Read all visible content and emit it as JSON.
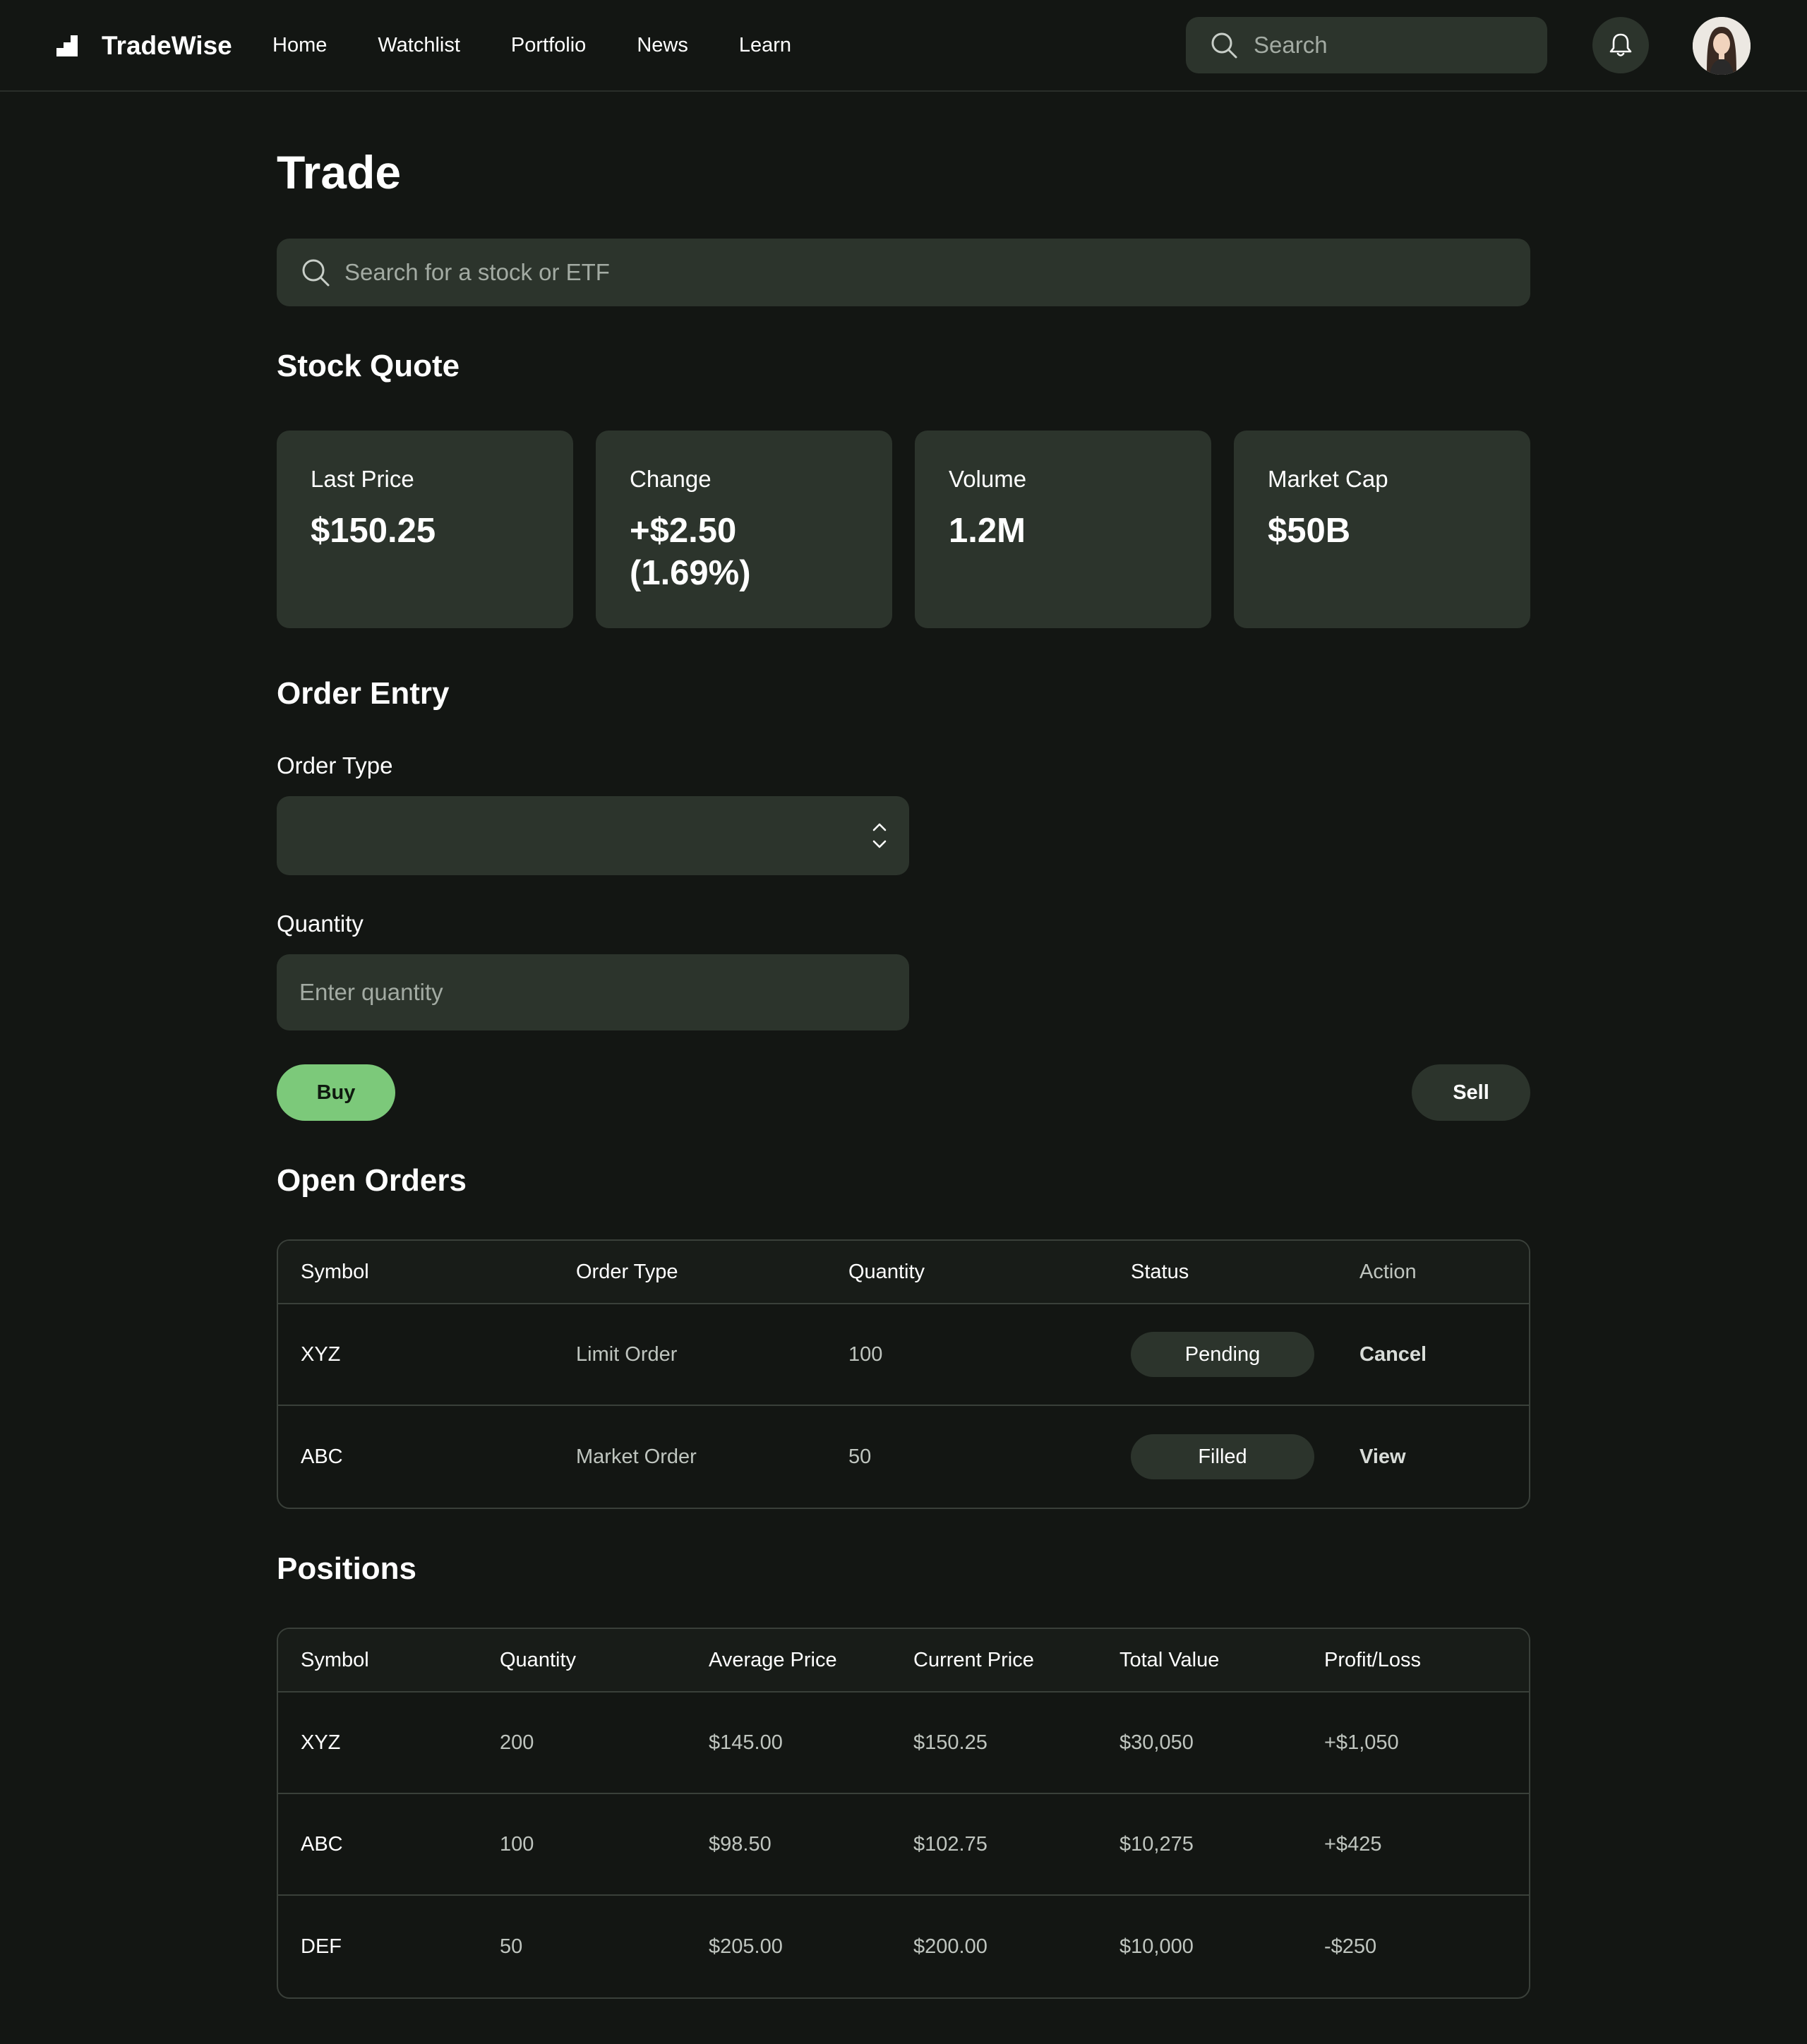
{
  "app": {
    "name": "TradeWise"
  },
  "nav": [
    {
      "label": "Home"
    },
    {
      "label": "Watchlist"
    },
    {
      "label": "Portfolio"
    },
    {
      "label": "News"
    },
    {
      "label": "Learn"
    }
  ],
  "header": {
    "search_placeholder": "Search"
  },
  "page": {
    "title": "Trade",
    "search_placeholder": "Search for a stock or ETF"
  },
  "quote": {
    "title": "Stock Quote",
    "cards": [
      {
        "label": "Last Price",
        "value": "$150.25"
      },
      {
        "label": "Change",
        "value": "+$2.50 (1.69%)"
      },
      {
        "label": "Volume",
        "value": "1.2M"
      },
      {
        "label": "Market Cap",
        "value": "$50B"
      }
    ]
  },
  "order_entry": {
    "title": "Order Entry",
    "order_type_label": "Order Type",
    "order_type_value": "",
    "quantity_label": "Quantity",
    "quantity_placeholder": "Enter quantity",
    "buy_label": "Buy",
    "sell_label": "Sell"
  },
  "open_orders": {
    "title": "Open Orders",
    "columns": [
      "Symbol",
      "Order Type",
      "Quantity",
      "Status",
      "Action"
    ],
    "rows": [
      {
        "symbol": "XYZ",
        "order_type": "Limit Order",
        "quantity": "100",
        "status": "Pending",
        "action": "Cancel"
      },
      {
        "symbol": "ABC",
        "order_type": "Market Order",
        "quantity": "50",
        "status": "Filled",
        "action": "View"
      }
    ]
  },
  "positions": {
    "title": "Positions",
    "columns": [
      "Symbol",
      "Quantity",
      "Average Price",
      "Current Price",
      "Total Value",
      "Profit/Loss"
    ],
    "rows": [
      {
        "symbol": "XYZ",
        "quantity": "200",
        "avg": "$145.00",
        "current": "$150.25",
        "total": "$30,050",
        "pl": "+$1,050"
      },
      {
        "symbol": "ABC",
        "quantity": "100",
        "avg": "$98.50",
        "current": "$102.75",
        "total": "$10,275",
        "pl": "+$425"
      },
      {
        "symbol": "DEF",
        "quantity": "50",
        "avg": "$205.00",
        "current": "$200.00",
        "total": "$10,000",
        "pl": "-$250"
      }
    ]
  },
  "colors": {
    "background": "#131613",
    "surface": "#2c342c",
    "accent": "#7cc97a",
    "border": "#3a403a"
  },
  "icons": [
    "logo-icon",
    "search-icon",
    "bell-icon",
    "avatar",
    "chevron-updown-icon"
  ]
}
